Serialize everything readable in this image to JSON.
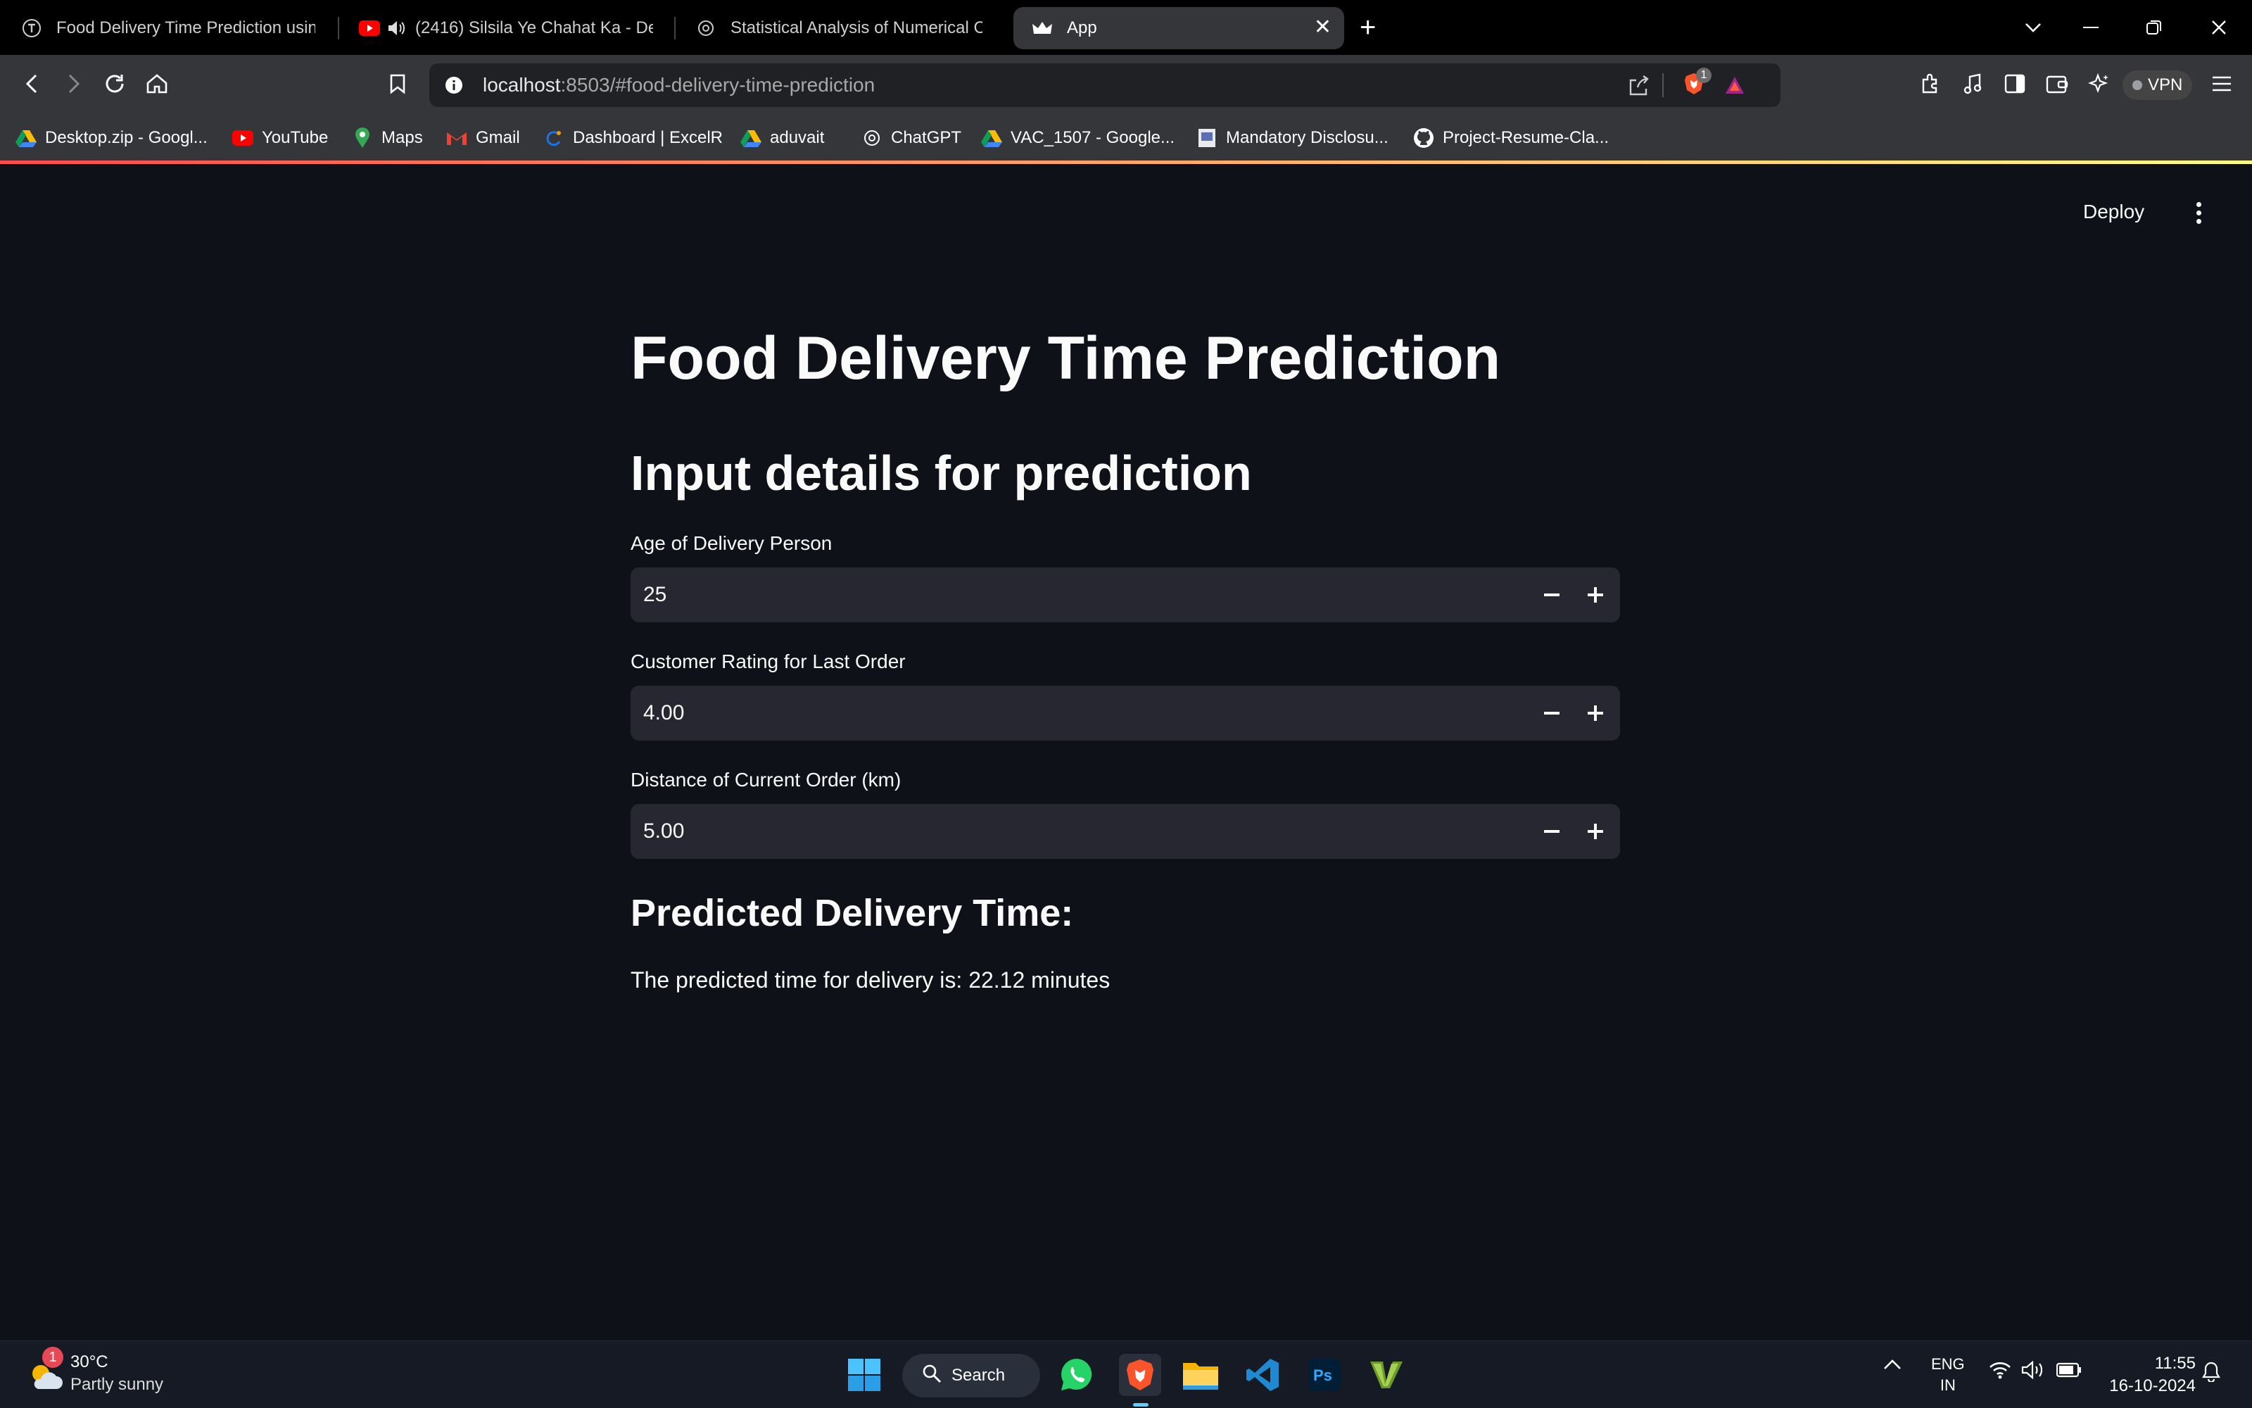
{
  "browser": {
    "tabs": [
      {
        "title": "Food Delivery Time Prediction using",
        "icon": "site-t-icon",
        "active": false
      },
      {
        "title": "(2416) Silsila Ye Chahat Ka - Dev",
        "icon": "youtube-icon",
        "playing_audio": true,
        "active": false
      },
      {
        "title": "Statistical Analysis of Numerical Col",
        "icon": "chatgpt-icon",
        "active": false
      },
      {
        "title": "App",
        "icon": "streamlit-crown-icon",
        "active": true
      }
    ],
    "url_host": "localhost",
    "url_rest": ":8503/#food-delivery-time-prediction",
    "shield_badge": "1",
    "vpn_label": "VPN",
    "bookmarks": [
      {
        "label": "Desktop.zip - Googl...",
        "icon": "google-drive-icon"
      },
      {
        "label": "YouTube",
        "icon": "youtube-icon"
      },
      {
        "label": "Maps",
        "icon": "maps-pin-icon"
      },
      {
        "label": "Gmail",
        "icon": "gmail-icon"
      },
      {
        "label": "Dashboard | ExcelR",
        "icon": "excelr-icon"
      },
      {
        "label": "aduvait",
        "icon": "google-drive-icon"
      },
      {
        "label": "ChatGPT",
        "icon": "chatgpt-icon"
      },
      {
        "label": "VAC_1507 - Google...",
        "icon": "google-drive-icon"
      },
      {
        "label": "Mandatory Disclosu...",
        "icon": "document-icon"
      },
      {
        "label": "Project-Resume-Cla...",
        "icon": "github-icon"
      }
    ]
  },
  "app": {
    "deploy_label": "Deploy",
    "title": "Food Delivery Time Prediction",
    "subtitle": "Input details for prediction",
    "fields": [
      {
        "label": "Age of Delivery Person",
        "value": "25"
      },
      {
        "label": "Customer Rating for Last Order",
        "value": "4.00"
      },
      {
        "label": "Distance of Current Order (km)",
        "value": "5.00"
      }
    ],
    "result_heading": "Predicted Delivery Time:",
    "result_text": "The predicted time for delivery is: 22.12 minutes"
  },
  "taskbar": {
    "weather_badge": "1",
    "temperature": "30°C",
    "weather": "Partly sunny",
    "search_label": "Search",
    "lang_top": "ENG",
    "lang_bottom": "IN",
    "time": "11:55",
    "date": "16-10-2024"
  },
  "colors": {
    "app_background": "#0e1117",
    "input_background": "#262730",
    "header_decoration_start": "#ff4b4b",
    "header_decoration_end": "#fffd80"
  }
}
